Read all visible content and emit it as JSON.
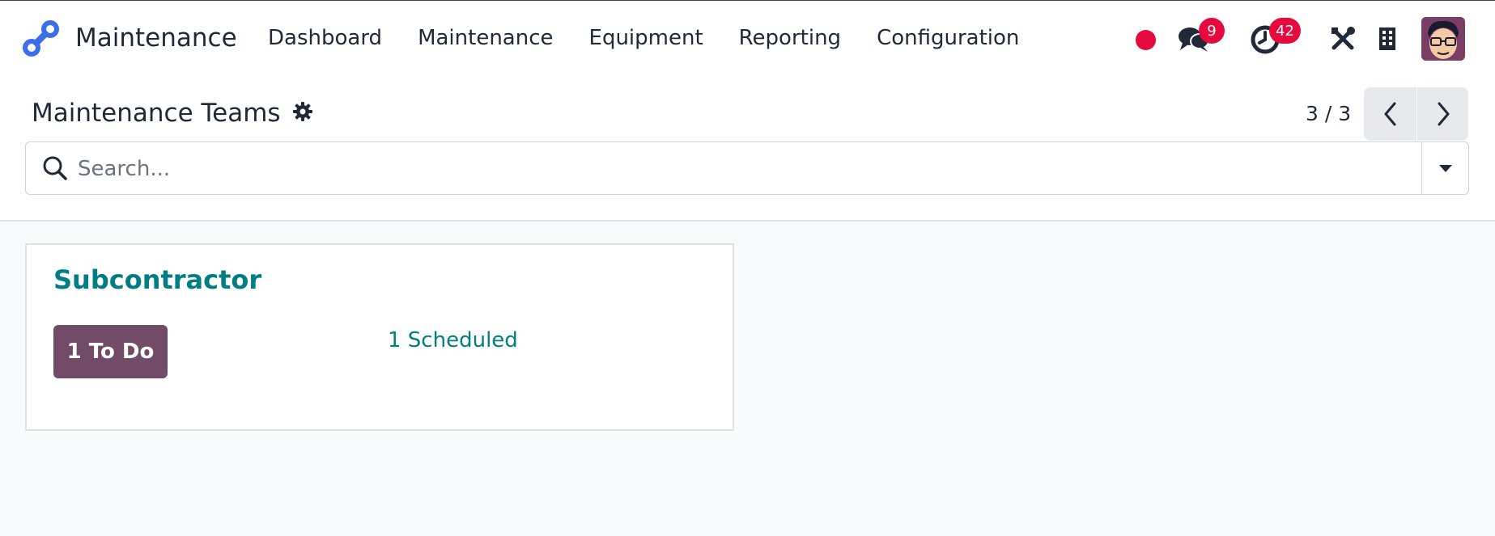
{
  "app": {
    "name": "Maintenance",
    "accent": "#714b67",
    "link_color": "#017e84"
  },
  "nav": {
    "items": [
      {
        "label": "Dashboard"
      },
      {
        "label": "Maintenance"
      },
      {
        "label": "Equipment"
      },
      {
        "label": "Reporting"
      },
      {
        "label": "Configuration"
      }
    ]
  },
  "systray": {
    "recording_indicator": "red-dot",
    "messages_icon": "chat-bubbles-icon",
    "messages_count": "9",
    "activities_icon": "clock-icon",
    "activities_count": "42",
    "debug_icon": "tools-icon",
    "company_icon": "building-icon",
    "user_avatar": "avatar"
  },
  "control_panel": {
    "title": "Maintenance Teams",
    "settings_icon": "gear-icon",
    "pager": "3 / 3"
  },
  "search": {
    "placeholder": "Search...",
    "value": ""
  },
  "kanban": {
    "cards": [
      {
        "team": "Subcontractor",
        "todo_label": "1 To Do",
        "scheduled_label": "1 Scheduled"
      }
    ]
  }
}
